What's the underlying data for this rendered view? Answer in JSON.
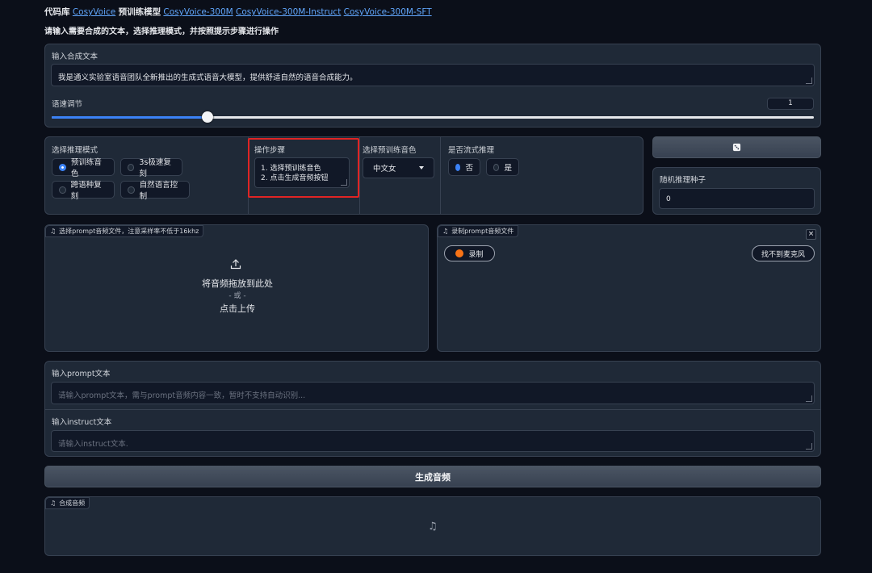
{
  "header": {
    "line_prefix": "代码库",
    "repo_link": "CosyVoice",
    "models_label": "预训练模型",
    "model_links": [
      "CosyVoice-300M",
      "CosyVoice-300M-Instruct",
      "CosyVoice-300M-SFT"
    ],
    "instruction": "请输入需要合成的文本，选择推理模式，并按照提示步骤进行操作"
  },
  "synthesis_text": {
    "label": "输入合成文本",
    "value": "我是通义实验室语音团队全新推出的生成式语音大模型，提供舒适自然的语音合成能力。"
  },
  "speed": {
    "label": "语速调节",
    "value": "1",
    "fraction": 0.2
  },
  "mode": {
    "label": "选择推理模式",
    "options": [
      "预训练音色",
      "3s极速复刻",
      "跨语种复刻",
      "自然语言控制"
    ],
    "selected": "预训练音色"
  },
  "steps": {
    "label": "操作步骤",
    "lines": [
      "1. 选择预训练音色",
      "2. 点击生成音频按钮"
    ]
  },
  "voice": {
    "label": "选择预训练音色",
    "value": "中文女"
  },
  "stream": {
    "label": "是否流式推理",
    "options": [
      "否",
      "是"
    ],
    "selected": "否"
  },
  "seed": {
    "dice_icon": "dice-icon",
    "label": "随机推理种子",
    "value": "0"
  },
  "upload": {
    "tag": "选择prompt音频文件，注意采样率不低于16khz",
    "drop_text": "将音频拖放到此处",
    "or_text": "- 或 -",
    "click_text": "点击上传"
  },
  "record": {
    "tag": "录制prompt音频文件",
    "record_label": "录制",
    "no_mic_label": "找不到麦克风"
  },
  "prompt_text": {
    "label": "输入prompt文本",
    "placeholder": "请输入prompt文本，需与prompt音频内容一致，暂时不支持自动识别..."
  },
  "instruct_text": {
    "label": "输入instruct文本",
    "placeholder": "请输入instruct文本."
  },
  "generate": {
    "label": "生成音频"
  },
  "output": {
    "tag": "合成音频"
  },
  "colors": {
    "highlight": "#e02424",
    "accent": "#3b82f6",
    "record_dot": "#f97316"
  }
}
